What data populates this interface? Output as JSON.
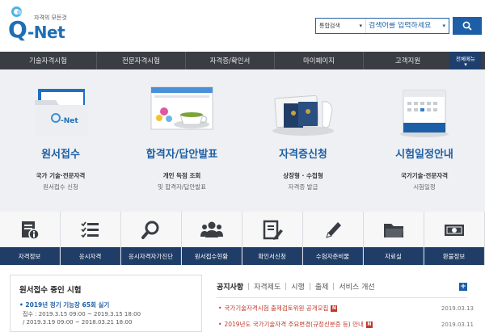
{
  "logo": {
    "mark_q": "Q",
    "mark_net": "-Net",
    "tagline": "자격의 모든것"
  },
  "search": {
    "scope": "통합검색",
    "placeholder": "검색어를 입력하세요",
    "button_icon": "search-icon"
  },
  "nav": {
    "items": [
      "기술자격시험",
      "전문자격시험",
      "자격증/확인서",
      "마이페이지",
      "고객지원"
    ],
    "more_label": "전체메뉴"
  },
  "features": [
    {
      "title": "원서접수",
      "sub1": "국가 기술·전문자격",
      "sub2": "원서접수 신청",
      "icon": "application-folder"
    },
    {
      "title": "합격자/답안발표",
      "sub1": "개인 득점 조회",
      "sub2": "및 합격자/답안발표",
      "icon": "browser-with-teacup"
    },
    {
      "title": "자격증신청",
      "sub1": "상장형 · 수첩형",
      "sub2": "자격증 발급",
      "icon": "passport-books"
    },
    {
      "title": "시험일정안내",
      "sub1": "국가기술·전문자격",
      "sub2": "시험일정",
      "icon": "calendar"
    }
  ],
  "quick_links": [
    {
      "label": "자격정보",
      "icon": "info-document-icon"
    },
    {
      "label": "응시자격",
      "icon": "checklist-icon"
    },
    {
      "label": "응시자격자가진단",
      "icon": "magnifier-icon"
    },
    {
      "label": "원서접수현황",
      "icon": "users-icon"
    },
    {
      "label": "확인서신청",
      "icon": "document-edit-icon"
    },
    {
      "label": "수험자준비물",
      "icon": "pencil-icon"
    },
    {
      "label": "자료실",
      "icon": "folder-icon"
    },
    {
      "label": "환불정보",
      "icon": "money-icon"
    }
  ],
  "ongoing_exams": {
    "title": "원서접수 중인 시험",
    "item": "2019년 정기 기능장 65회 실기",
    "line1": "접수 : 2019.3.15 09:00 ~ 2019.3.15 18:00",
    "line2": "/ 2019.3.19 09:00 ~ 2018.03.21 18:00"
  },
  "notices": {
    "tabs": [
      "공지사항",
      "자격제도",
      "시행",
      "출제",
      "서비스 개선"
    ],
    "items": [
      {
        "text": "국가기술자격시험 출제검토위원 공개모집",
        "date": "2019.03.13",
        "new": "N"
      },
      {
        "text": "2019년도 국가기술자격 주요변경(규정신분증 등) 안내",
        "date": "2019.03.11",
        "new": "N"
      }
    ],
    "more_label": "+"
  },
  "colors": {
    "brand": "#1d5fa6",
    "nav_bg": "#3a3d44",
    "quick_bar": "#1f3d66",
    "notice": "#c0392b"
  }
}
